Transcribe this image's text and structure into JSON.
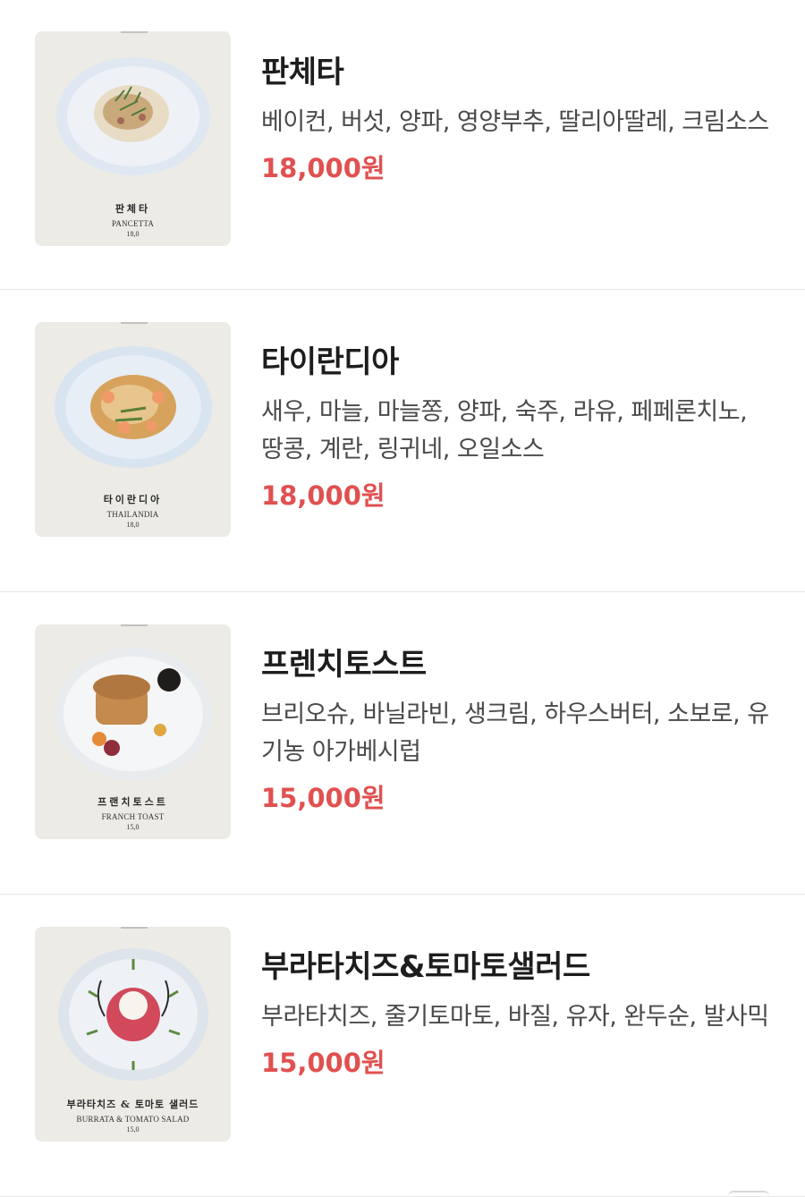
{
  "items": [
    {
      "name": "판체타",
      "description": "베이컨, 버섯, 양파, 영양부추, 딸리아딸레, 크림소스",
      "price": "18,000원",
      "image": {
        "caption_ko": "판체타",
        "caption_en": "PANCETTA",
        "caption_price": "18,0"
      }
    },
    {
      "name": "타이란디아",
      "description": "새우, 마늘, 마늘쫑, 양파, 숙주, 라유, 페페론치노, 땅콩, 계란, 링귀네, 오일소스",
      "price": "18,000원",
      "image": {
        "caption_ko": "타이란디아",
        "caption_en": "THAILANDIA",
        "caption_price": "18,0"
      }
    },
    {
      "name": "프렌치토스트",
      "description": "브리오슈, 바닐라빈, 생크림, 하우스버터, 소보로, 유기농 아가베시럽",
      "price": "15,000원",
      "image": {
        "caption_ko": "프랜치토스트",
        "caption_en": "FRANCH TOAST",
        "caption_price": "15,0"
      }
    },
    {
      "name": "부라타치즈&토마토샐러드",
      "description": "부라타치즈, 줄기토마토, 바질, 유자, 완두순, 발사믹",
      "price": "15,000원",
      "image": {
        "caption_ko": "부라타치즈 & 토마토 샐러드",
        "caption_en": "BURRATA & TOMATO SALAD",
        "caption_price": "15,0"
      }
    }
  ],
  "colors": {
    "price": "#e15050",
    "card_bg": "#ecebe6",
    "divider": "#e6e6e6"
  }
}
